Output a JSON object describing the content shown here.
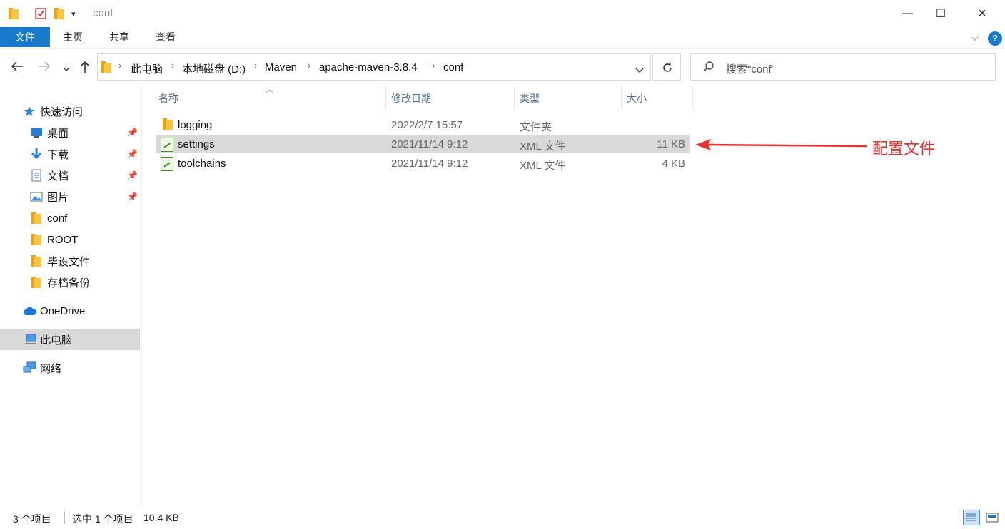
{
  "window": {
    "title": "conf",
    "controls": {
      "minimize": "—",
      "maximize": "☐",
      "close": "✕"
    }
  },
  "ribbon": {
    "tabs": [
      "文件",
      "主页",
      "共享",
      "查看"
    ],
    "help": "?"
  },
  "address": {
    "crumbs": [
      "此电脑",
      "本地磁盘 (D:)",
      "Maven",
      "apache-maven-3.8.4",
      "conf"
    ]
  },
  "search": {
    "placeholder": "搜索\"conf\""
  },
  "nav": {
    "quick_access": "快速访问",
    "items": [
      {
        "label": "桌面",
        "icon": "desktop-icon",
        "pinned": true
      },
      {
        "label": "下载",
        "icon": "download-icon",
        "pinned": true
      },
      {
        "label": "文档",
        "icon": "document-icon",
        "pinned": true
      },
      {
        "label": "图片",
        "icon": "picture-icon",
        "pinned": true
      },
      {
        "label": "conf",
        "icon": "folder-icon",
        "pinned": false
      },
      {
        "label": "ROOT",
        "icon": "folder-icon",
        "pinned": false
      },
      {
        "label": "毕设文件",
        "icon": "folder-icon",
        "pinned": false
      },
      {
        "label": "存档备份",
        "icon": "folder-icon",
        "pinned": false
      }
    ],
    "onedrive": "OneDrive",
    "this_pc": "此电脑",
    "network": "网络"
  },
  "columns": {
    "name": "名称",
    "date": "修改日期",
    "type": "类型",
    "size": "大小"
  },
  "files": [
    {
      "name": "logging",
      "date": "2022/2/7 15:57",
      "type": "文件夹",
      "size": "",
      "icon": "folder-icon"
    },
    {
      "name": "settings",
      "date": "2021/11/14 9:12",
      "type": "XML 文件",
      "size": "11 KB",
      "icon": "xml-file-icon"
    },
    {
      "name": "toolchains",
      "date": "2021/11/14 9:12",
      "type": "XML 文件",
      "size": "4 KB",
      "icon": "xml-file-icon"
    }
  ],
  "annotation": {
    "text": "配置文件",
    "color": "#e8302f"
  },
  "status": {
    "count": "3 个项目",
    "selected": "选中 1 个项目",
    "size": "10.4 KB"
  },
  "colors": {
    "accent": "#1979ca",
    "selection": "#d9d9d9"
  }
}
